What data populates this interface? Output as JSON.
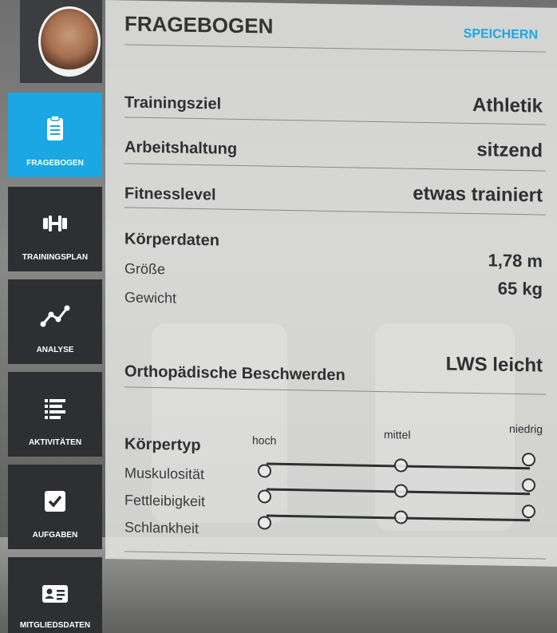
{
  "sidebar": {
    "avatar_alt": "",
    "items": [
      {
        "label": "FRAGEBOGEN",
        "icon": "clipboard-icon",
        "active": true
      },
      {
        "label": "TRAININGSPLAN",
        "icon": "dumbbell-icon",
        "active": false
      },
      {
        "label": "ANALYSE",
        "icon": "line-graph-icon",
        "active": false
      },
      {
        "label": "AKTIVITÄTEN",
        "icon": "list-icon",
        "active": false
      },
      {
        "label": "AUFGABEN",
        "icon": "checkbox-icon",
        "active": false
      },
      {
        "label": "MITGLIEDSDATEN",
        "icon": "id-card-icon",
        "active": false
      }
    ]
  },
  "form": {
    "title": "FRAGEBOGEN",
    "save_label": "SPEICHERN",
    "training_goal": {
      "label": "Trainingsziel",
      "value": "Athletik"
    },
    "work_posture": {
      "label": "Arbeitshaltung",
      "value": "sitzend"
    },
    "fitness_level": {
      "label": "Fitnesslevel",
      "value": "etwas trainiert"
    },
    "body_data": {
      "label": "Körperdaten",
      "height_label": "Größe",
      "height_value": "1,78 m",
      "weight_label": "Gewicht",
      "weight_value": "65 kg"
    },
    "orthopedic": {
      "label": "Orthopädische Beschwerden",
      "value": "LWS leicht"
    },
    "body_type": {
      "label": "Körpertyp",
      "columns": [
        "hoch",
        "mittel",
        "niedrig"
      ],
      "rows": [
        {
          "label": "Muskulosität"
        },
        {
          "label": "Fettleibigkeit"
        },
        {
          "label": "Schlankheit"
        }
      ]
    }
  },
  "colors": {
    "accent": "#1aa7e3",
    "sidebar": "#2d2f33",
    "text": "#2f3033"
  }
}
